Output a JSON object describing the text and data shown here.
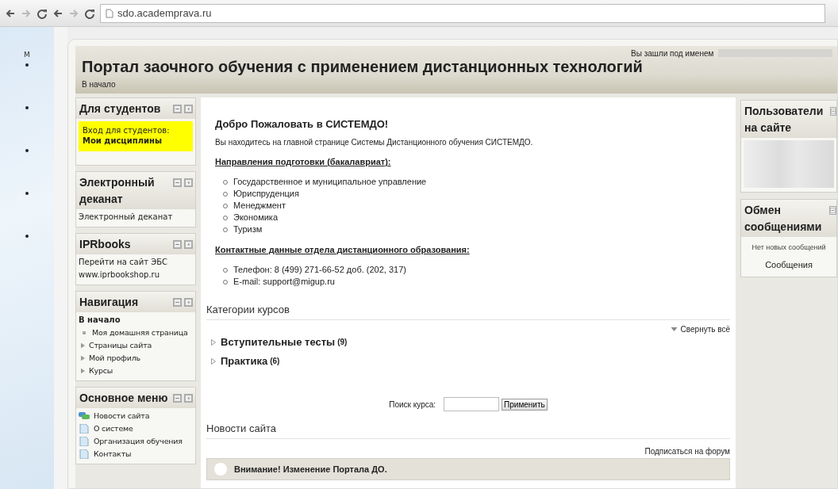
{
  "browser": {
    "address": "sdo.academprava.ru"
  },
  "left_strip": {
    "label": "M"
  },
  "header": {
    "title": "Портал заочного обучения с применением дистанционных технологий",
    "login_label": "Вы зашли под именем",
    "breadcrumb": "В начало"
  },
  "left_blocks": [
    {
      "title": "Для студентов",
      "kind": "highlight",
      "intro": "Вход для студентов:",
      "link": "Мои дисциплины"
    },
    {
      "title": "Электронный деканат",
      "kind": "links",
      "items": [
        "Электронный деканат"
      ]
    },
    {
      "title": "IPRbooks",
      "kind": "links",
      "items": [
        "Перейти на сайт ЭБС",
        "www.iprbookshop.ru"
      ]
    },
    {
      "title": "Навигация",
      "kind": "navigation",
      "home": "В начало",
      "items": [
        {
          "label": "Моя домашняя страница",
          "expandable": false
        },
        {
          "label": "Страницы сайта",
          "expandable": true
        },
        {
          "label": "Мой профиль",
          "expandable": true
        },
        {
          "label": "Курсы",
          "expandable": true
        }
      ]
    },
    {
      "title": "Основное меню",
      "kind": "menu",
      "items": [
        {
          "label": "Новости сайта",
          "kind": "forum"
        },
        {
          "label": "О системе",
          "kind": "page"
        },
        {
          "label": "Организация обучения",
          "kind": "page"
        },
        {
          "label": "Контакты",
          "kind": "page"
        }
      ]
    }
  ],
  "welcome": {
    "heading": "Добро Пожаловать в СИСТЕМДО!",
    "intro": "Вы находитесь на главной странице Системы Дистанционного обучения СИСТЕМДО.",
    "directions_heading": "Направления подготовки (бакалавриат):",
    "directions": [
      "Государственное и муниципальное управление",
      "Юриспруденция",
      "Менеджмент",
      "Экономика",
      "Туризм"
    ],
    "contacts_heading": "Контактные данные отдела дистанционного образования:",
    "contacts": [
      "Телефон: 8 (499) 271-66-52 доб. (202, 317)",
      "E-mail: support@migup.ru"
    ]
  },
  "categories": {
    "heading": "Категории курсов",
    "collapse_all": "Свернуть всё",
    "items": [
      {
        "name": "Вступительные тесты",
        "count": "(9)"
      },
      {
        "name": "Практика",
        "count": "(6)"
      }
    ]
  },
  "search": {
    "label": "Поиск курса:",
    "button": "Применить"
  },
  "news": {
    "heading": "Новости сайта",
    "subscribe": "Подписаться на форум",
    "posts": [
      {
        "title": "Внимание! Изменение Портала ДО."
      }
    ]
  },
  "right_blocks": [
    {
      "title": "Пользователи на сайте",
      "kind": "users"
    },
    {
      "title": "Обмен сообщениями",
      "kind": "messages",
      "status": "Нет новых сообщений",
      "link": "Сообщения"
    }
  ]
}
